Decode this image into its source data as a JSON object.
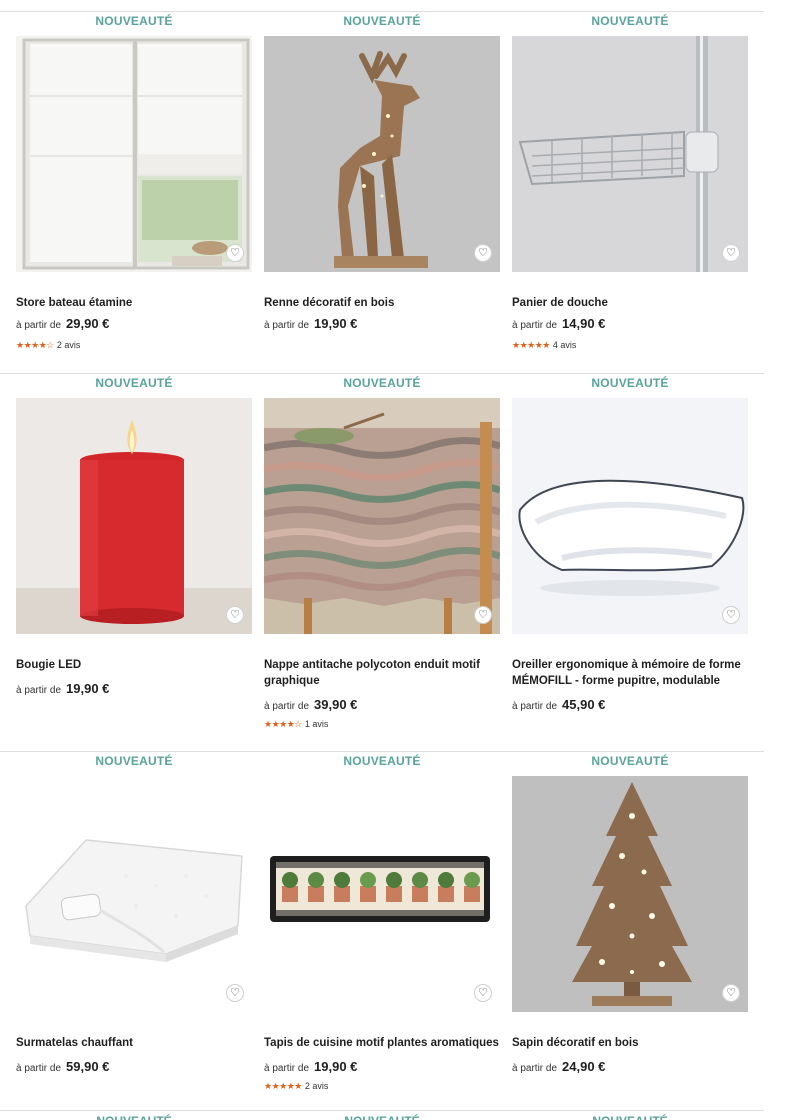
{
  "badge_text": "NOUVEAUTÉ",
  "price_prefix": "à partir de",
  "favorite_glyph": "♡",
  "colors": {
    "badge": "#5aa39c",
    "stars": "#e2601b",
    "divider": "#dedede"
  },
  "products": [
    {
      "title": "Store bateau étamine",
      "price": "29,90 €",
      "stars": "★★★★☆",
      "reviews": "2 avis",
      "rating": 4,
      "image_icon": "roman-blind-window"
    },
    {
      "title": "Renne décoratif en bois",
      "price": "19,90 €",
      "stars": "",
      "reviews": "",
      "image_icon": "wooden-reindeer"
    },
    {
      "title": "Panier de douche",
      "price": "14,90 €",
      "stars": "★★★★★",
      "reviews": "4 avis",
      "rating": 5,
      "image_icon": "shower-basket"
    },
    {
      "title": "Bougie LED",
      "price": "19,90 €",
      "stars": "",
      "reviews": "",
      "image_icon": "red-led-candle"
    },
    {
      "title": "Nappe antitache polycoton enduit motif graphique",
      "price": "39,90 €",
      "stars": "★★★★☆",
      "reviews": "1 avis",
      "rating": 4,
      "image_icon": "patterned-tablecloth"
    },
    {
      "title": "Oreiller ergonomique à mémoire de forme MÉMOFILL - forme pupitre, modulable",
      "price": "45,90 €",
      "stars": "",
      "reviews": "",
      "image_icon": "white-pillow"
    },
    {
      "title": "Surmatelas chauffant",
      "price": "59,90 €",
      "stars": "",
      "reviews": "",
      "image_icon": "heated-mattress-topper"
    },
    {
      "title": "Tapis de cuisine motif plantes aromatiques",
      "price": "19,90 €",
      "stars": "★★★★★",
      "reviews": "2 avis",
      "rating": 5,
      "image_icon": "herb-kitchen-rug"
    },
    {
      "title": "Sapin décoratif en bois",
      "price": "24,90 €",
      "stars": "",
      "reviews": "",
      "image_icon": "wooden-tree"
    }
  ]
}
